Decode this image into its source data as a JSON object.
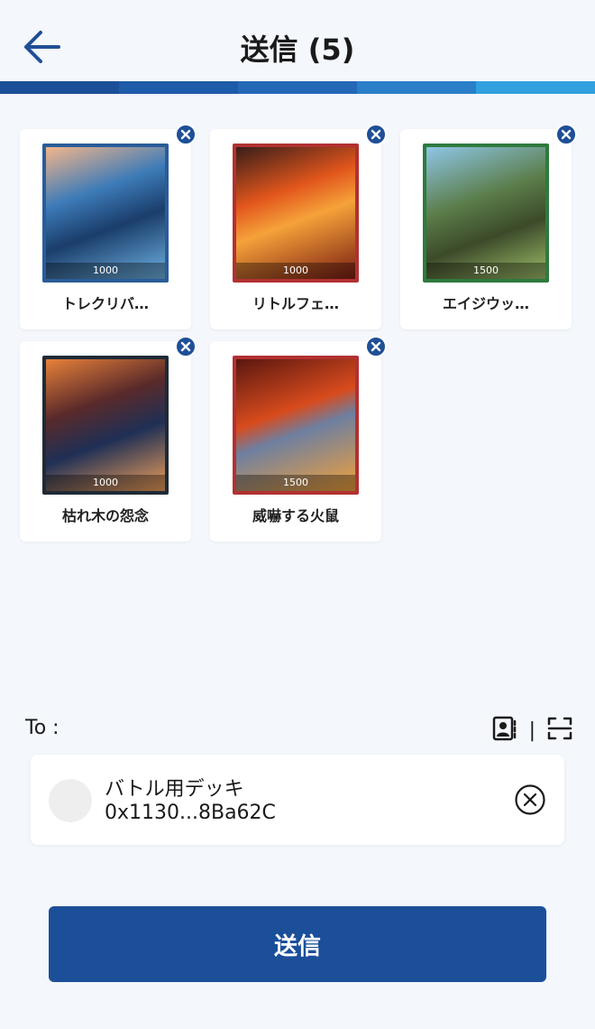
{
  "header": {
    "title": "送信 (5)"
  },
  "progress_colors": [
    "#1b4f97",
    "#1e5ba8",
    "#2468b6",
    "#2a7fc8",
    "#32a0de"
  ],
  "cards": [
    {
      "name": "トレクリバ…",
      "stat": "1000",
      "frame": "#2a5c9a",
      "art": "linear-gradient(160deg,#f3b58a 0%,#3d7bb8 35%,#1a3d6b 60%,#6fb3e2 100%)"
    },
    {
      "name": "リトルフェ…",
      "stat": "1000",
      "frame": "#b23131",
      "art": "linear-gradient(160deg,#3a1d1a 0%,#e2561c 35%,#f5a23a 55%,#7a1d12 100%)"
    },
    {
      "name": "エイジウッ…",
      "stat": "1500",
      "frame": "#2f7a3e",
      "art": "linear-gradient(160deg,#8ec6e6 0%,#5b7d4a 40%,#3c4a2a 65%,#9fbf6a 100%)"
    },
    {
      "name": "枯れ木の怨念",
      "stat": "1000",
      "frame": "#1f2a36",
      "art": "linear-gradient(160deg,#e8813a 0%,#5a2a2a 35%,#1f2f55 60%,#f0a05a 100%)"
    },
    {
      "name": "威嚇する火鼠",
      "stat": "1500",
      "frame": "#b23131",
      "art": "linear-gradient(160deg,#5a1710 0%,#d84b1d 40%,#6e7fa0 55%,#f2a13a 100%)"
    }
  ],
  "to": {
    "label": "To :",
    "divider": "|"
  },
  "recipient": {
    "name": "バトル用デッキ",
    "address": "0x1130...8Ba62C"
  },
  "send_button": {
    "label": "送信"
  }
}
